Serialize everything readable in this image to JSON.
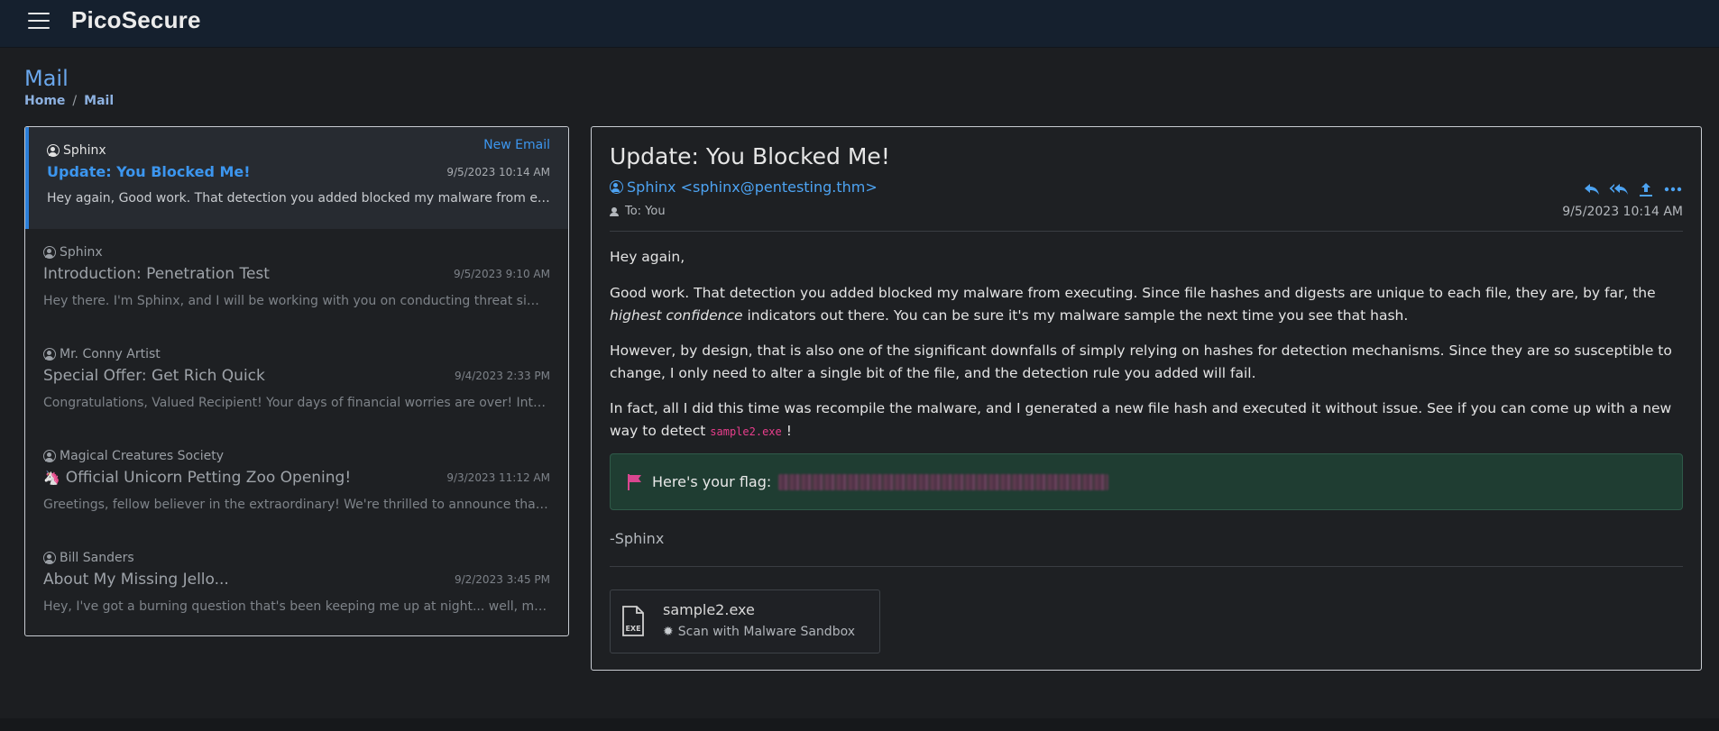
{
  "app": {
    "brand": "PicoSecure"
  },
  "page": {
    "title": "Mail",
    "breadcrumb": {
      "home": "Home",
      "separator": "/",
      "current": "Mail"
    }
  },
  "inbox": {
    "new_email_label": "New Email",
    "emails": [
      {
        "sender": "Sphinx",
        "subject": "Update: You Blocked Me!",
        "time": "9/5/2023 10:14 AM",
        "preview": "Hey again, Good work. That detection you added blocked my malware from executing. Since file hashes and digests are unique to each file, they are, by far, the highest confidence indicators out there."
      },
      {
        "sender": "Sphinx",
        "subject": "Introduction: Penetration Test",
        "time": "9/5/2023 9:10 AM",
        "preview": "Hey there. I'm Sphinx, and I will be working with you on conducting threat simulations and penetration tests."
      },
      {
        "sender": "Mr. Conny Artist",
        "subject": "Special Offer: Get Rich Quick",
        "time": "9/4/2023 2:33 PM",
        "preview": "Congratulations, Valued Recipient! Your days of financial worries are over! Introducing our exclusive offer."
      },
      {
        "sender": "Magical Creatures Society",
        "subject_emoji": "🦄",
        "subject": "Official Unicorn Petting Zoo Opening!",
        "time": "9/3/2023 11:12 AM",
        "preview": "Greetings, fellow believer in the extraordinary! We're thrilled to announce that the Magical Creatures Society..."
      },
      {
        "sender": "Bill Sanders",
        "subject": "About My Missing Jello...",
        "time": "9/2/2023 3:45 PM",
        "preview": "Hey, I've got a burning question that's been keeping me up at night... well, maybe not literally."
      }
    ]
  },
  "detail": {
    "subject": "Update: You Blocked Me!",
    "from": "Sphinx <sphinx@pentesting.thm>",
    "to": "To: You",
    "time": "9/5/2023 10:14 AM",
    "actions": [
      "reply-icon",
      "reply-all-icon",
      "forward-icon",
      "more-icon"
    ],
    "body": {
      "greeting": "Hey again,",
      "p1_start": "Good work. That detection you added blocked my malware from executing. Since file hashes and digests are unique to each file, they are, by far, the ",
      "p1_em": "highest confidence",
      "p1_end": " indicators out there. You can be sure it's my malware sample the next time you see that hash.",
      "p2": "However, by design, that is also one of the significant downfalls of simply relying on hashes for detection mechanisms. Since they are so susceptible to change, I only need to alter a single bit of the file, and the detection rule you added will fail.",
      "p3_start": "In fact, all I did this time was recompile the malware, and I generated a new file hash and executed it without issue. See if you can come up with a new way to detect ",
      "p3_code": "sample2.exe",
      "p3_end": " !"
    },
    "flag_label": "Here's your flag:",
    "signoff": "-Sphinx",
    "attachment": {
      "name": "sample2.exe",
      "icon_text": "EXE",
      "action": "Scan with Malware Sandbox"
    }
  },
  "colors": {
    "accent": "#3c96ef",
    "topbar": "#15202e",
    "background": "#1c1e21",
    "flag_bg": "#1f3d32",
    "code": "#e83e8c"
  }
}
